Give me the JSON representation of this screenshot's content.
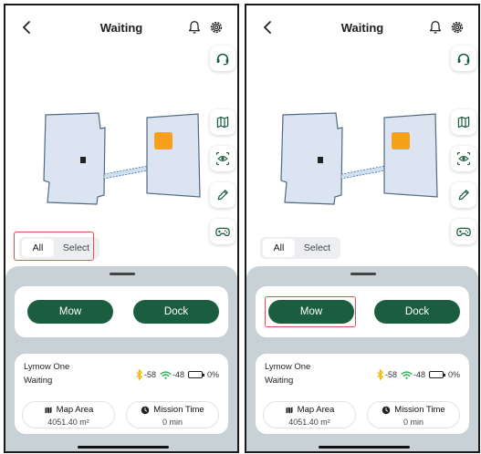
{
  "header": {
    "title": "Waiting"
  },
  "segment": {
    "all_label": "All",
    "select_label": "Select"
  },
  "actions": {
    "mow_label": "Mow",
    "dock_label": "Dock"
  },
  "device": {
    "name": "Lymow One",
    "state": "Waiting",
    "bluetooth_signal": "-58",
    "wifi_signal": "-48",
    "battery_percent": "0%",
    "battery_level": 0
  },
  "stats": {
    "map_area_label": "Map Area",
    "map_area_value": "4051.40 m²",
    "mission_time_label": "Mission Time",
    "mission_time_value": "0 min"
  },
  "colors": {
    "accent_green": "#1b5e3f",
    "highlight_red": "#e54c4c",
    "sheet_bg": "#c7d1d6",
    "zone_fill": "#dbe4f0",
    "zone_stroke": "#4f6a86",
    "station_orange": "#f7a11a",
    "bluetooth_yellow": "#f5b800",
    "wifi_green": "#2bb24c",
    "battery_red": "#d94040"
  },
  "icons": [
    "chevron-left-icon",
    "bell-icon",
    "gear-icon",
    "headset-icon",
    "map-icon",
    "eye-icon",
    "pencil-icon",
    "gamepad-icon",
    "bluetooth-icon",
    "wifi-icon",
    "battery-icon",
    "map-area-icon",
    "clock-icon"
  ]
}
